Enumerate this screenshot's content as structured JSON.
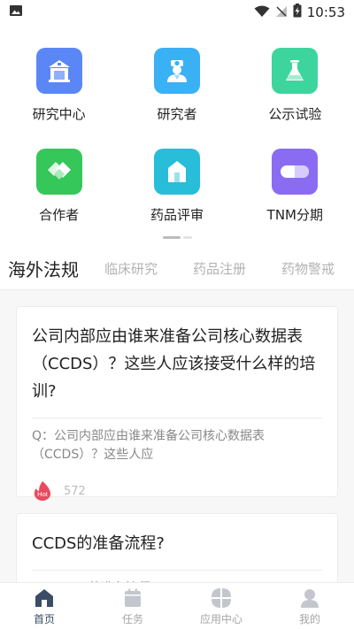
{
  "status_bar": {
    "time": "10:53"
  },
  "grid": [
    {
      "label": "研究中心",
      "icon": "building-icon",
      "color": "#5b86f5"
    },
    {
      "label": "研究者",
      "icon": "doctor-icon",
      "color": "#3ab0f5"
    },
    {
      "label": "公示试验",
      "icon": "flask-icon",
      "color": "#3dd59d"
    },
    {
      "label": "合作者",
      "icon": "handshake-icon",
      "color": "#36c75a"
    },
    {
      "label": "药品评审",
      "icon": "house-icon",
      "color": "#28bdd8"
    },
    {
      "label": "TNM分期",
      "icon": "pill-icon",
      "color": "#8a6cf2"
    }
  ],
  "tabs": [
    {
      "label": "海外法规",
      "active": true
    },
    {
      "label": "临床研究",
      "active": false
    },
    {
      "label": "药品注册",
      "active": false
    },
    {
      "label": "药物警戒",
      "active": false
    }
  ],
  "articles": [
    {
      "title": "公司内部应由谁来准备公司核心数据表（CCDS）？这些人应该接受什么样的培训?",
      "summary": "Q：公司内部应由谁来准备公司核心数据表（CCDS）？这些人应",
      "badge": "Hot",
      "views": "572"
    },
    {
      "title": "CCDS的准备流程?",
      "summary": "Q：CCDS的准备流程?"
    }
  ],
  "bottom_nav": [
    {
      "label": "首页",
      "icon": "home-icon",
      "active": true
    },
    {
      "label": "任务",
      "icon": "calendar-icon",
      "active": false
    },
    {
      "label": "应用中心",
      "icon": "apps-icon",
      "active": false
    },
    {
      "label": "我的",
      "icon": "profile-icon",
      "active": false
    }
  ],
  "colors": {
    "accent": "#3a4d66",
    "hot": "#e94a5d"
  }
}
